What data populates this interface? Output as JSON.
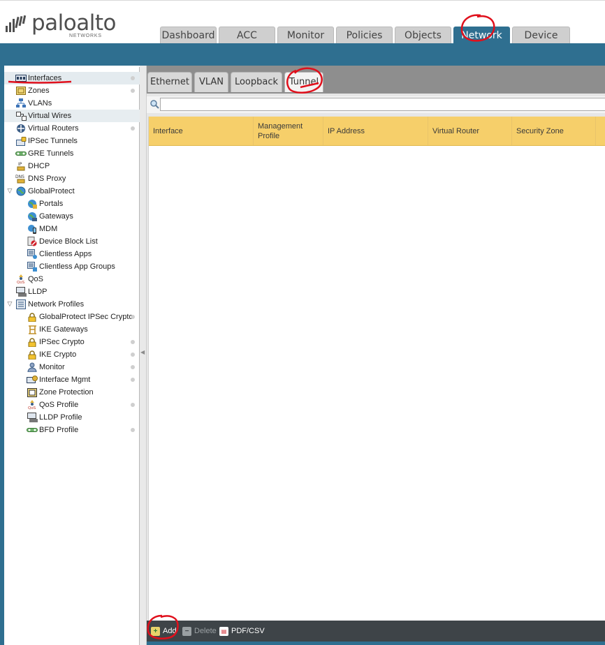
{
  "brand": {
    "wordmark": "paloalto",
    "subline": "NETWORKS",
    "bar_color": "#4f4f4f"
  },
  "main_tabs": [
    {
      "label": "Dashboard",
      "active": false
    },
    {
      "label": "ACC",
      "active": false
    },
    {
      "label": "Monitor",
      "active": false
    },
    {
      "label": "Policies",
      "active": false
    },
    {
      "label": "Objects",
      "active": false
    },
    {
      "label": "Network",
      "active": true
    },
    {
      "label": "Device",
      "active": false
    }
  ],
  "sidebar": {
    "items": [
      {
        "label": "Interfaces",
        "icon": "interfaces-icon",
        "selected": true
      },
      {
        "label": "Zones",
        "icon": "zones-icon"
      },
      {
        "label": "VLANs",
        "icon": "vlans-icon"
      },
      {
        "label": "Virtual Wires",
        "icon": "virtual-wires-icon"
      },
      {
        "label": "Virtual Routers",
        "icon": "virtual-routers-icon"
      },
      {
        "label": "IPSec Tunnels",
        "icon": "ipsec-tunnels-icon"
      },
      {
        "label": "GRE Tunnels",
        "icon": "gre-tunnels-icon"
      },
      {
        "label": "DHCP",
        "icon": "dhcp-icon"
      },
      {
        "label": "DNS Proxy",
        "icon": "dns-proxy-icon"
      },
      {
        "label": "GlobalProtect",
        "icon": "globalprotect-icon",
        "expanded": true
      },
      {
        "label": "Portals",
        "icon": "portals-icon"
      },
      {
        "label": "Gateways",
        "icon": "gateways-icon"
      },
      {
        "label": "MDM",
        "icon": "mdm-icon"
      },
      {
        "label": "Device Block List",
        "icon": "device-block-list-icon"
      },
      {
        "label": "Clientless Apps",
        "icon": "clientless-apps-icon"
      },
      {
        "label": "Clientless App Groups",
        "icon": "clientless-app-groups-icon"
      },
      {
        "label": "QoS",
        "icon": "qos-icon"
      },
      {
        "label": "LLDP",
        "icon": "lldp-icon"
      },
      {
        "label": "Network Profiles",
        "icon": "network-profiles-icon",
        "expanded": true
      },
      {
        "label": "GlobalProtect IPSec Crypto",
        "icon": "lock-icon"
      },
      {
        "label": "IKE Gateways",
        "icon": "ike-gateways-icon"
      },
      {
        "label": "IPSec Crypto",
        "icon": "lock-icon"
      },
      {
        "label": "IKE Crypto",
        "icon": "lock-icon"
      },
      {
        "label": "Monitor",
        "icon": "monitor-profile-icon"
      },
      {
        "label": "Interface Mgmt",
        "icon": "interface-mgmt-icon"
      },
      {
        "label": "Zone Protection",
        "icon": "zone-protection-icon"
      },
      {
        "label": "QoS Profile",
        "icon": "qos-profile-icon"
      },
      {
        "label": "LLDP Profile",
        "icon": "lldp-profile-icon"
      },
      {
        "label": "BFD Profile",
        "icon": "bfd-profile-icon"
      }
    ]
  },
  "sub_tabs": [
    {
      "label": "Ethernet",
      "active": false
    },
    {
      "label": "VLAN",
      "active": false
    },
    {
      "label": "Loopback",
      "active": false
    },
    {
      "label": "Tunnel",
      "active": true
    }
  ],
  "filter": {
    "value": "",
    "placeholder": ""
  },
  "table": {
    "columns": [
      "Interface",
      "Management Profile",
      "IP Address",
      "Virtual Router",
      "Security Zone"
    ],
    "rows": []
  },
  "toolbar": {
    "add_label": "Add",
    "delete_label": "Delete",
    "pdfcsv_label": "PDF/CSV"
  },
  "colors": {
    "accent_blue": "#2f6f90",
    "table_header": "#f6cf6a",
    "annotation_red": "#e0101c",
    "toolbar_bg": "#3e4448"
  }
}
